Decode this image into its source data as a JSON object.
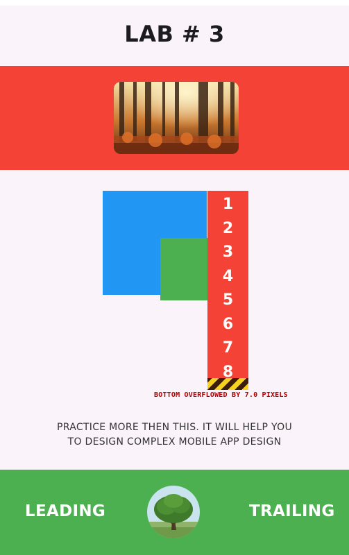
{
  "app": {
    "title": "LAB # 3"
  },
  "numbers": [
    "1",
    "2",
    "3",
    "4",
    "5",
    "6",
    "7",
    "8"
  ],
  "overflow_warning": "BOTTOM OVERFLOWED BY 7.0 PIXELS",
  "description": {
    "line1": "PRACTICE MORE THEN THIS. IT WILL HELP YOU",
    "line2": "TO DESIGN COMPLEX MOBILE APP DESIGN"
  },
  "footer": {
    "leading": "LEADING",
    "trailing": "TRAILING"
  },
  "colors": {
    "red": "#f44336",
    "blue": "#2196f3",
    "green": "#4caf50",
    "background": "#fbf3fa"
  },
  "images": {
    "banner": "forest-sunlight-image",
    "avatar": "tree-avatar-image"
  }
}
